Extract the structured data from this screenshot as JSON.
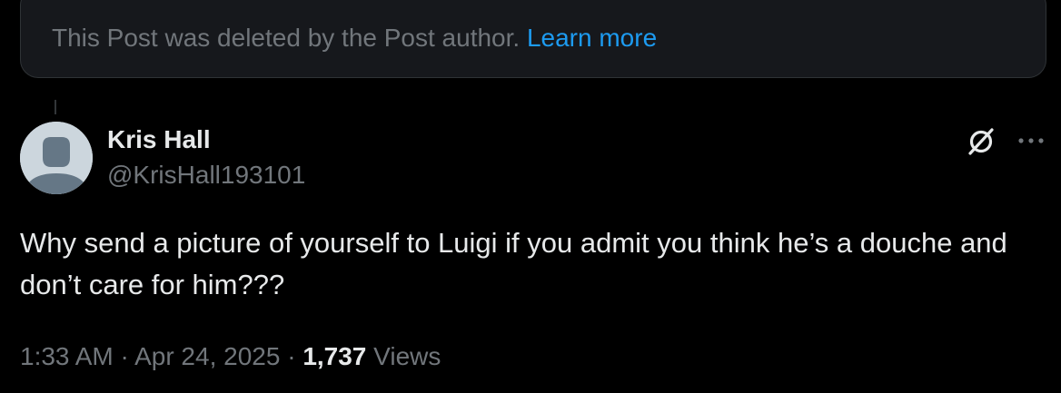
{
  "deleted_notice": {
    "text": "This Post was deleted by the Post author.",
    "link": "Learn more"
  },
  "post": {
    "author": {
      "display_name": "Kris Hall",
      "handle": "@KrisHall193101"
    },
    "text": "Why send a picture of yourself to Luigi if you admit you think he’s a douche and don’t care for him???",
    "time": "1:33 AM",
    "separator": "·",
    "date": "Apr 24, 2025",
    "views_count": "1,737",
    "views_label": "Views"
  },
  "icons": {
    "grok": "grok-icon",
    "more": "more-options-icon",
    "avatar": "default-avatar-icon"
  },
  "colors": {
    "background": "#000000",
    "card": "#16181c",
    "border": "#2f3336",
    "primary_text": "#e7e9ea",
    "secondary_text": "#71767b",
    "link": "#1d9bf0",
    "avatar_bg": "#ccd6dd",
    "avatar_fg": "#657786"
  }
}
